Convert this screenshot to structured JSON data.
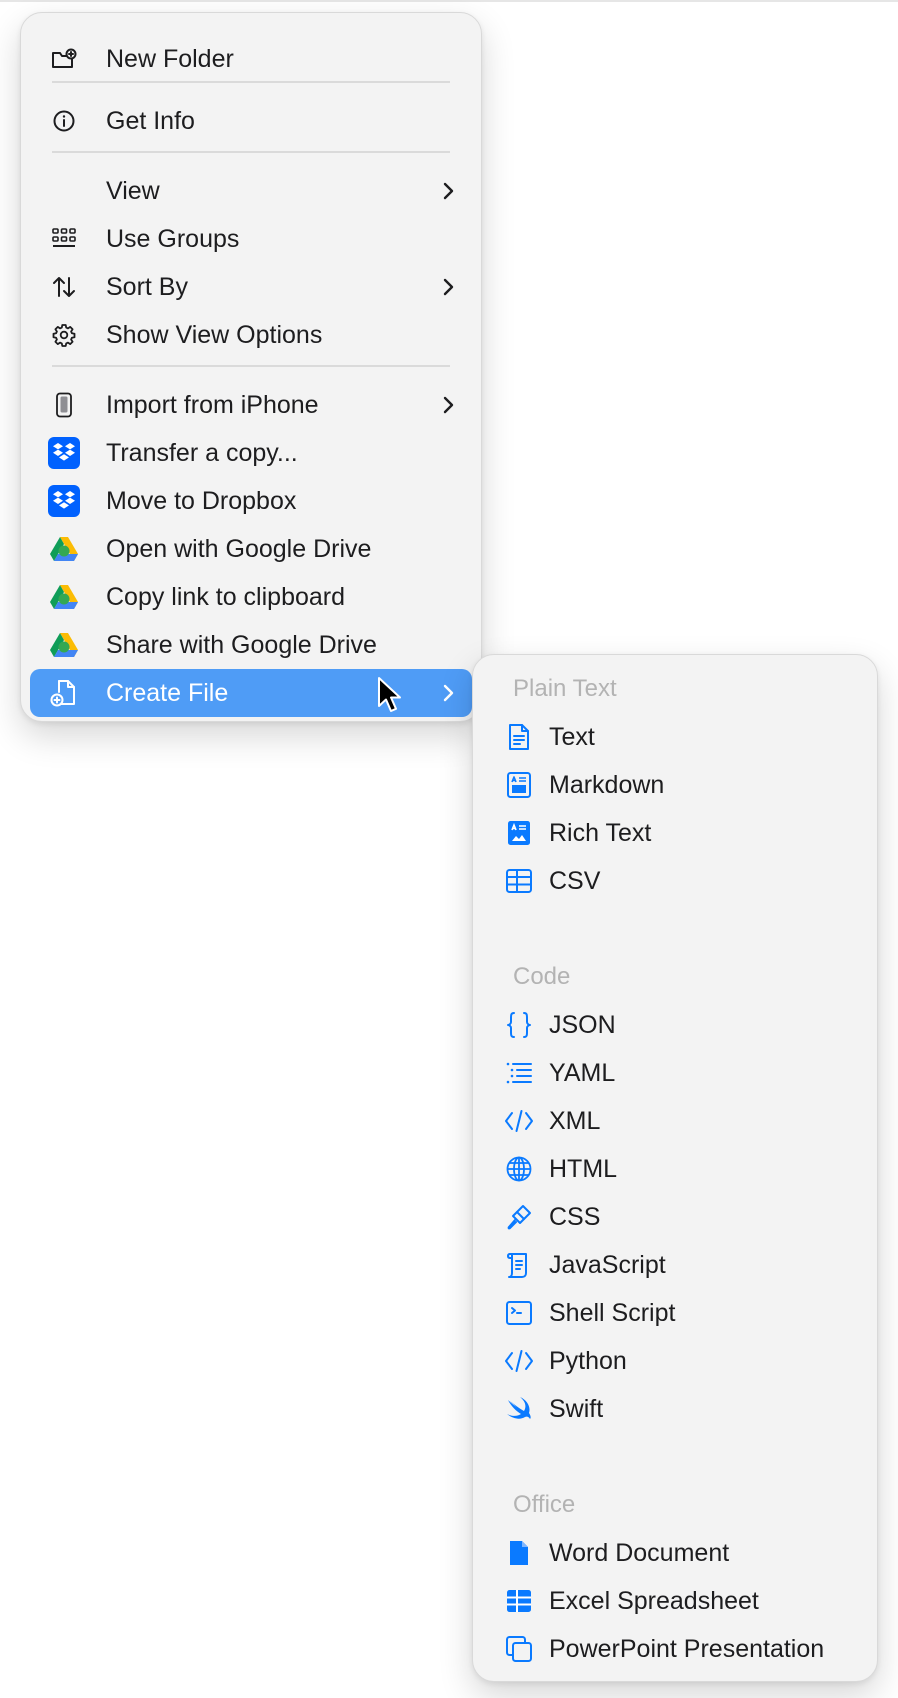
{
  "main_menu": {
    "items": [
      {
        "label": "New Folder",
        "icon": "folder-plus-icon"
      },
      {
        "label": "Get Info",
        "icon": "info-circle-icon"
      },
      {
        "label": "View",
        "submenu": true
      },
      {
        "label": "Use Groups",
        "icon": "grid-groups-icon"
      },
      {
        "label": "Sort By",
        "icon": "sort-arrows-icon",
        "submenu": true
      },
      {
        "label": "Show View Options",
        "icon": "gear-icon"
      },
      {
        "label": "Import from iPhone",
        "icon": "iphone-icon",
        "submenu": true
      },
      {
        "label": "Transfer a copy...",
        "icon": "dropbox-icon"
      },
      {
        "label": "Move to Dropbox",
        "icon": "dropbox-icon"
      },
      {
        "label": "Open with Google Drive",
        "icon": "google-drive-icon"
      },
      {
        "label": "Copy link to clipboard",
        "icon": "google-drive-icon"
      },
      {
        "label": "Share with Google Drive",
        "icon": "google-drive-icon"
      },
      {
        "label": "Create File",
        "icon": "file-plus-icon",
        "submenu": true,
        "highlighted": true
      }
    ]
  },
  "create_file_submenu": {
    "sections": [
      {
        "header": "Plain Text",
        "items": [
          {
            "label": "Text",
            "icon": "doc-text-icon"
          },
          {
            "label": "Markdown",
            "icon": "doc-richtext-icon"
          },
          {
            "label": "Rich Text",
            "icon": "doc-richtext-filled-icon"
          },
          {
            "label": "CSV",
            "icon": "table-icon"
          }
        ]
      },
      {
        "header": "Code",
        "items": [
          {
            "label": "JSON",
            "icon": "curly-braces-icon"
          },
          {
            "label": "YAML",
            "icon": "list-indent-icon"
          },
          {
            "label": "XML",
            "icon": "code-brackets-icon"
          },
          {
            "label": "HTML",
            "icon": "globe-icon"
          },
          {
            "label": "CSS",
            "icon": "paintbrush-icon"
          },
          {
            "label": "JavaScript",
            "icon": "scroll-icon"
          },
          {
            "label": "Shell Script",
            "icon": "terminal-icon"
          },
          {
            "label": "Python",
            "icon": "code-brackets-icon"
          },
          {
            "label": "Swift",
            "icon": "swift-icon"
          }
        ]
      },
      {
        "header": "Office",
        "items": [
          {
            "label": "Word Document",
            "icon": "doc-filled-icon"
          },
          {
            "label": "Excel Spreadsheet",
            "icon": "table-filled-icon"
          },
          {
            "label": "PowerPoint Presentation",
            "icon": "presentation-icon"
          }
        ]
      }
    ]
  },
  "colors": {
    "accent": "#0a7aff",
    "highlight": "#4f9cf6",
    "dropbox": "#0061fe",
    "section_header": "#b3b3b3"
  }
}
